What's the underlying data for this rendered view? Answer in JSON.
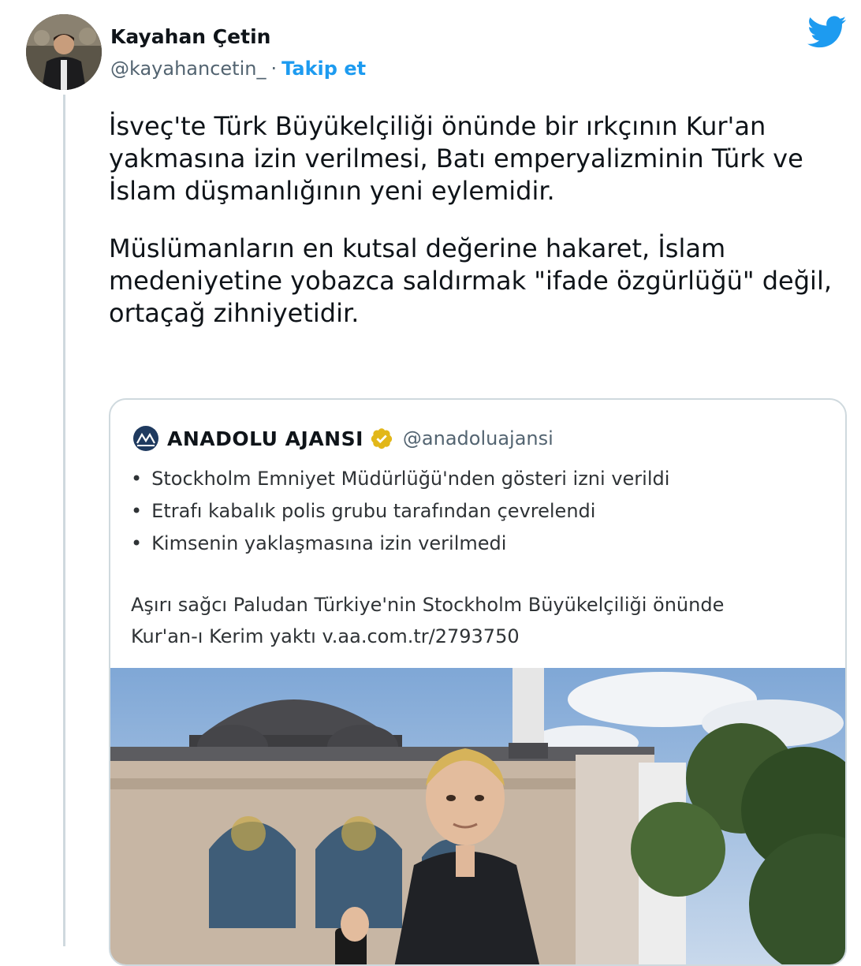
{
  "author": {
    "display_name": "Kayahan Çetin",
    "handle": "@kayahancetin_",
    "separator": "·",
    "follow_label": "Takip et"
  },
  "tweet": {
    "paragraphs": [
      "İsveç'te Türk Büyükelçiliği önünde bir ırkçının Kur'an yakmasına izin verilmesi, Batı emperyalizminin Türk ve İslam düşmanlığının yeni eylemidir.",
      "Müslümanların en kutsal değerine hakaret, İslam medeniyetine yobazca saldırmak \"ifade özgürlüğü\" değil, ortaçağ zihniyetidir."
    ]
  },
  "quoted_tweet": {
    "name": "ANADOLU AJANSI",
    "handle": "@anadoluajansi",
    "bullets": [
      "Stockholm Emniyet Müdürlüğü'nden gösteri izni verildi",
      "Etrafı kabalık polis grubu tarafından çevrelendi",
      "Kimsenin yaklaşmasına izin verilmedi"
    ],
    "body_line1": "Aşırı sağcı Paludan Türkiye'nin Stockholm Büyükelçiliği önünde",
    "body_line2": "Kur'an-ı Kerim yaktı v.aa.com.tr/2793750"
  },
  "colors": {
    "twitter_blue": "#1d9bf0",
    "verified_gold": "#e2b719",
    "secondary_text": "#536471"
  },
  "icons": [
    "twitter-bird-icon",
    "verified-badge-icon",
    "anadolu-agency-logo"
  ]
}
